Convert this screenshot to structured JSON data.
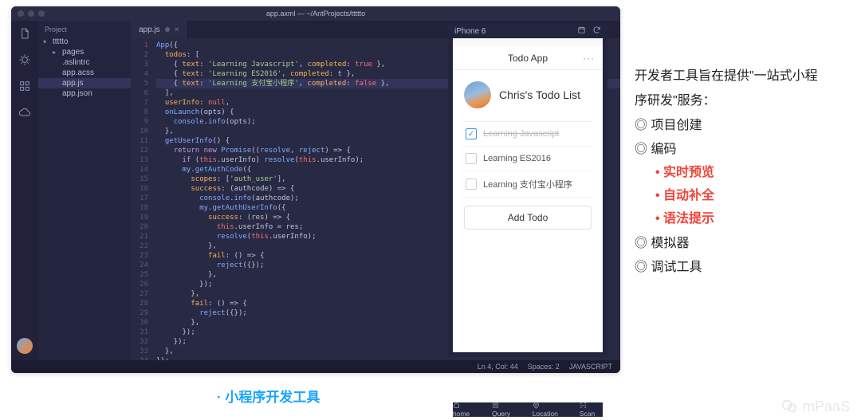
{
  "window": {
    "title": "app.axml — ~/AntProjects/ttttto"
  },
  "sidebar": {
    "title": "Project",
    "items": [
      {
        "label": "ttttto",
        "depth": 0,
        "chev": "▾",
        "kind": "folder"
      },
      {
        "label": "pages",
        "depth": 1,
        "chev": "▸",
        "kind": "folder"
      },
      {
        "label": ".aslintrc",
        "depth": 1,
        "chev": "",
        "kind": "file"
      },
      {
        "label": "app.acss",
        "depth": 1,
        "chev": "",
        "kind": "file"
      },
      {
        "label": "app.js",
        "depth": 1,
        "chev": "",
        "kind": "file",
        "selected": true
      },
      {
        "label": "app.json",
        "depth": 1,
        "chev": "",
        "kind": "file"
      }
    ]
  },
  "tab": {
    "label": "app.js",
    "dirty": true
  },
  "code": [
    "App({",
    "  todos: [",
    "    { text: 'Learning Javascript', completed: true },",
    "    { text: 'Learning ES2016', completed: t },",
    "    { text: 'Learning 支付宝小程序', completed: false },",
    "  ],",
    "  userInfo: null,",
    "  onLaunch(opts) {",
    "    console.info(opts);",
    "  },",
    "  getUserInfo() {",
    "    return new Promise((resolve, reject) => {",
    "      if (this.userInfo) resolve(this.userInfo);",
    "",
    "      my.getAuthCode({",
    "        scopes: ['auth_user'],",
    "        success: (authcode) => {",
    "          console.info(authcode);",
    "",
    "          my.getAuthUserInfo({",
    "            success: (res) => {",
    "              this.userInfo = res;",
    "              resolve(this.userInfo);",
    "            },",
    "            fail: () => {",
    "              reject({});",
    "            },",
    "          });",
    "        },",
    "        fail: () => {",
    "          reject({});",
    "        },",
    "      });",
    "    });",
    "  },",
    "});"
  ],
  "status": {
    "lncol": "Ln 4, Col: 44",
    "spaces": "Spaces: 2",
    "lang": "JAVASCRIPT"
  },
  "simulator": {
    "device": "iPhone 6",
    "nav_title": "Todo App",
    "nav_more": "···",
    "header": "Chris's Todo List",
    "todos": [
      {
        "text": "Learning Javascript",
        "done": true
      },
      {
        "text": "Learning ES2016",
        "done": false
      },
      {
        "text": "Learning 支付宝小程序",
        "done": false
      }
    ],
    "add_label": "Add Todo",
    "bottombar": [
      "home",
      "Query",
      "Location",
      "Scan"
    ]
  },
  "notes": {
    "intro1": "开发者工具旨在提供\"一站式小程",
    "intro2": "序研发\"服务：",
    "l1": [
      "项目创建",
      "编码",
      "模拟器",
      "调试工具"
    ],
    "l2": [
      "实时预览",
      "自动补全",
      "语法提示"
    ]
  },
  "caption": "小程序开发工具",
  "watermark": "mPaaS"
}
